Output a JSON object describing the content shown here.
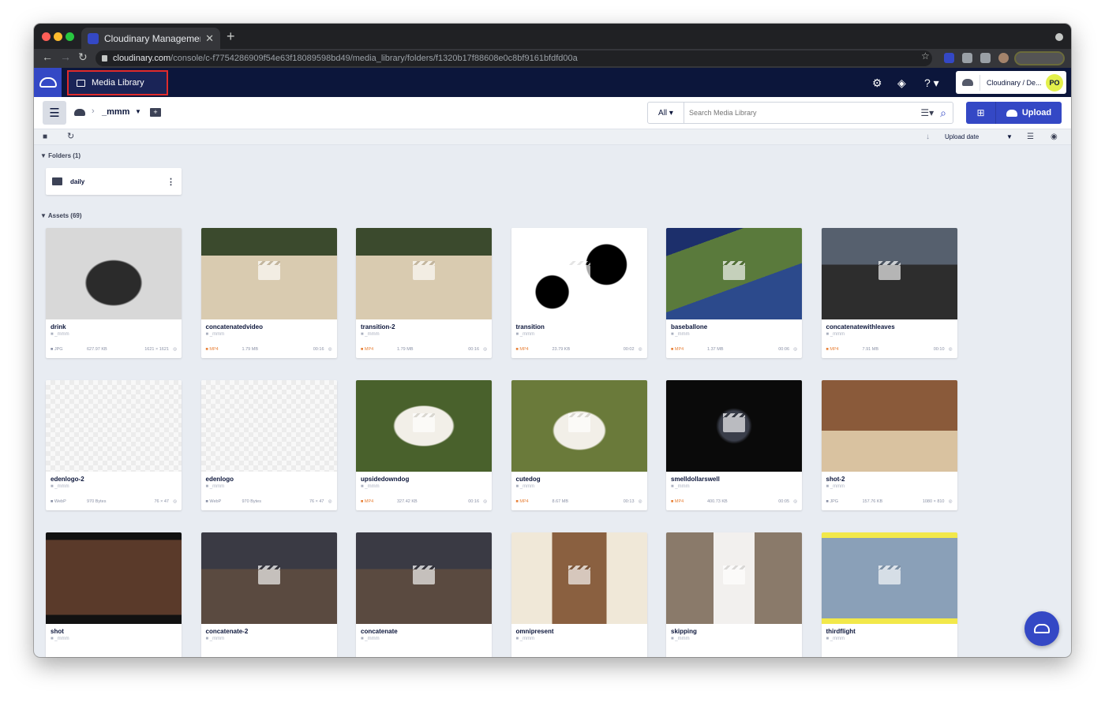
{
  "browser": {
    "tab_title": "Cloudinary Management Conso",
    "url_host": "cloudinary.com",
    "url_path": "/console/c-f7754286909f54e63f18089598bd49/media_library/folders/f1320b17f88608e0c8bf9161bfdfd00a"
  },
  "header": {
    "active_tab": "Media Library",
    "account_name": "Cloudinary / De...",
    "avatar_initials": "PO"
  },
  "toolbar": {
    "current_folder": "_mmm",
    "search_scope": "All",
    "search_placeholder": "Search Media Library",
    "upload_label": "Upload",
    "sort_label": "Upload date"
  },
  "folders": {
    "title": "Folders (1)",
    "items": [
      {
        "name": "daily"
      }
    ]
  },
  "assets": {
    "title": "Assets (69)",
    "items": [
      {
        "name": "drink",
        "folder": "_mmm",
        "format": "JPG",
        "size": "627.97 KB",
        "dims": "1621 × 1621",
        "video": false
      },
      {
        "name": "concatenatedvideo",
        "folder": "_mmm",
        "format": "MP4",
        "size": "1.79 MB",
        "dims": "00:16",
        "video": true
      },
      {
        "name": "transition-2",
        "folder": "_mmm",
        "format": "MP4",
        "size": "1.79 MB",
        "dims": "00:16",
        "video": true
      },
      {
        "name": "transition",
        "folder": "_mmm",
        "format": "MP4",
        "size": "23.79 KB",
        "dims": "00:02",
        "video": true
      },
      {
        "name": "baseballone",
        "folder": "_mmm",
        "format": "MP4",
        "size": "1.37 MB",
        "dims": "00:06",
        "video": true
      },
      {
        "name": "concatenatewithleaves",
        "folder": "_mmm",
        "format": "MP4",
        "size": "7.91 MB",
        "dims": "00:10",
        "video": true
      },
      {
        "name": "edenlogo-2",
        "folder": "_mmm",
        "format": "WebP",
        "size": "970 Bytes",
        "dims": "76 × 47",
        "video": false
      },
      {
        "name": "edenlogo",
        "folder": "_mmm",
        "format": "WebP",
        "size": "970 Bytes",
        "dims": "76 × 47",
        "video": false
      },
      {
        "name": "upsidedowndog",
        "folder": "_mmm",
        "format": "MP4",
        "size": "327.42 KB",
        "dims": "00:16",
        "video": true
      },
      {
        "name": "cutedog",
        "folder": "_mmm",
        "format": "MP4",
        "size": "8.67 MB",
        "dims": "00:13",
        "video": true
      },
      {
        "name": "smelldollarswell",
        "folder": "_mmm",
        "format": "MP4",
        "size": "400.73 KB",
        "dims": "00:05",
        "video": true
      },
      {
        "name": "shot-2",
        "folder": "_mmm",
        "format": "JPG",
        "size": "157.76 KB",
        "dims": "1080 × 810",
        "video": false
      },
      {
        "name": "shot",
        "folder": "_mmm",
        "format": "",
        "size": "",
        "dims": "",
        "video": false
      },
      {
        "name": "concatenate-2",
        "folder": "_mmm",
        "format": "",
        "size": "",
        "dims": "",
        "video": true
      },
      {
        "name": "concatenate",
        "folder": "_mmm",
        "format": "",
        "size": "",
        "dims": "",
        "video": true
      },
      {
        "name": "omnipresent",
        "folder": "_mmm",
        "format": "",
        "size": "",
        "dims": "",
        "video": true
      },
      {
        "name": "skipping",
        "folder": "_mmm",
        "format": "",
        "size": "",
        "dims": "",
        "video": true
      },
      {
        "name": "thirdflight",
        "folder": "_mmm",
        "format": "",
        "size": "",
        "dims": "",
        "video": true
      }
    ]
  },
  "colors": {
    "brand": "#3448c5",
    "header_bg": "#0c163b",
    "highlight": "#e02b2b",
    "video_format": "#e8823a"
  }
}
